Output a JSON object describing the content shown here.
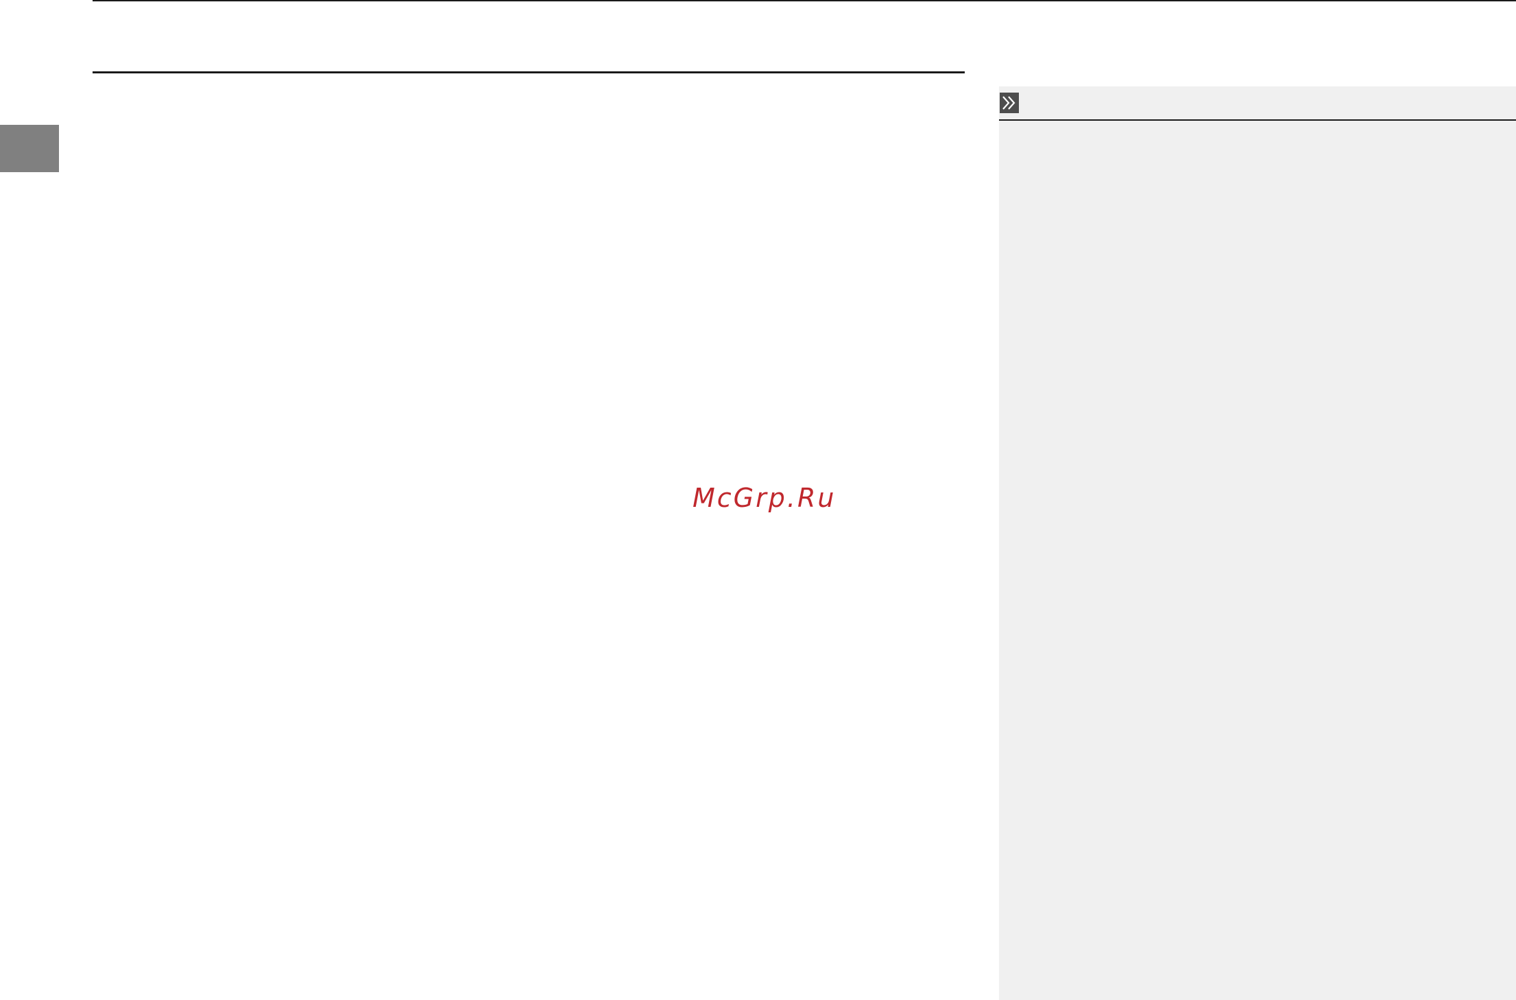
{
  "page": {
    "background": "#ffffff"
  },
  "chapter_tab": {
    "color": "#808080"
  },
  "side_panel": {
    "background": "#f0f0f0",
    "icon": "double-chevron-right-icon"
  },
  "watermark": {
    "text": "McGrp.Ru",
    "color": "#c0282d"
  }
}
